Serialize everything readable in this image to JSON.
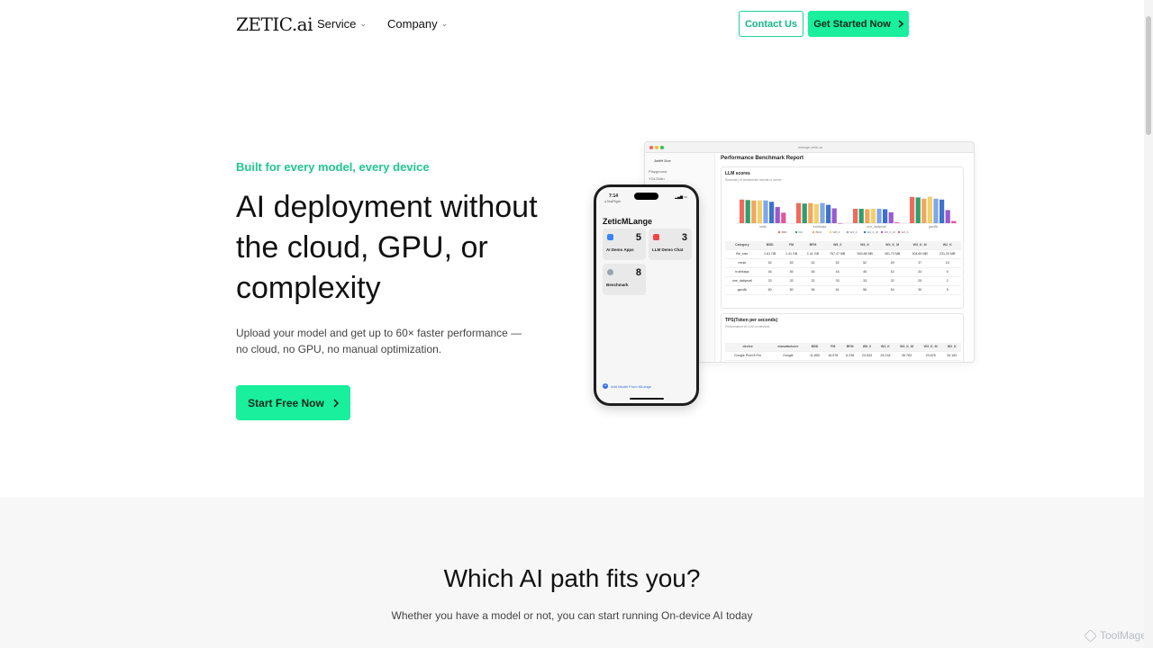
{
  "header": {
    "logo": "ZETIC.ai",
    "nav": [
      {
        "label": "Service"
      },
      {
        "label": "Company"
      }
    ],
    "contact_label": "Contact Us",
    "get_started_label": "Get Started Now"
  },
  "hero": {
    "eyebrow": "Built for every model, every device",
    "title": "AI deployment without the cloud, GPU, or complexity",
    "subtitle": "Upload your model and get up to 60× faster performance — no cloud, no GPU, no manual optimization.",
    "cta_label": "Start Free Now"
  },
  "browser_mock": {
    "url": "mlange.zetic.ai",
    "sidebar_user": "JaHH Doe",
    "sidebar_items": [
      "Playground",
      "YOLOv8n"
    ],
    "report_title": "Performance Benchmark Report",
    "llm_card_title": "LLM scores",
    "llm_card_subtitle": "Summary of benchmark results in server",
    "chart_groups": [
      "mmlu",
      "truthfulqa",
      "one_dailymail",
      "gsm8k"
    ],
    "chart_legend": [
      "BBD",
      "FM",
      "BFM",
      "W8_0",
      "W4_K",
      "W4_K_M",
      "W3_K_M",
      "W2_K"
    ],
    "score_table": {
      "headers": [
        "Category",
        "BBD",
        "FM",
        "BFM",
        "W8_0",
        "W4_K",
        "W4_K_M",
        "W3_K_M",
        "W2_K"
      ],
      "rows": [
        [
          "file_size",
          "2.81 GB",
          "1.41 GB",
          "1.41 GB",
          "767.47 MB",
          "593.88 MB",
          "451.73 MB",
          "304.60 MB",
          "231.20 MB"
        ],
        [
          "mmlu",
          "54",
          "53",
          "52",
          "52",
          "52",
          "49",
          "37",
          "24"
        ],
        [
          "truthfulqa",
          "46",
          "45",
          "46",
          "44",
          "46",
          "42",
          "34",
          "0"
        ],
        [
          "one_dailymail",
          "33",
          "33",
          "32",
          "33",
          "33",
          "32",
          "25",
          "2"
        ],
        [
          "gsm8k",
          "60",
          "59",
          "56",
          "61",
          "56",
          "54",
          "30",
          "5"
        ]
      ]
    },
    "tps_card_title": "TPS(Token per seconds)",
    "tps_card_subtitle": "Performance of LLM on devices",
    "tps_table": {
      "headers": [
        "device",
        "manufacturer",
        "BBD",
        "FM",
        "BFM",
        "W8_0",
        "W4_K",
        "W4_K_M",
        "W3_K_M",
        "W2_K"
      ],
      "rows": [
        [
          "Google Pixel 8 Pro",
          "Google",
          "11.850",
          "16.578",
          "6.238",
          "23.543",
          "25.218",
          "36.783",
          "29.878",
          "34.162"
        ]
      ]
    }
  },
  "phone_mock": {
    "time": "7:14",
    "back": "◂ TestFlight",
    "app_title": "ZeticMLange",
    "tiles": [
      {
        "count": "5",
        "label": "AI Demo Apps",
        "color": "#3b82f6"
      },
      {
        "count": "3",
        "label": "LLM Demo Chat",
        "color": "#ef4444"
      },
      {
        "count": "8",
        "label": "Benchmark",
        "color": "#9ca3af"
      }
    ],
    "add_label": "Add Model From MLange"
  },
  "section2": {
    "title": "Which AI path fits you?",
    "subtitle": "Whether you have a model or not, you can start running On-device AI today"
  },
  "watermark": "ToolMage",
  "colors": {
    "accent": "#19ef9d",
    "accent_text": "#21c78f",
    "bar_palette": [
      "#ef6a5a",
      "#2f9e6e",
      "#f2a65a",
      "#f2d16b",
      "#7fa6e8",
      "#3c72c9",
      "#9b59d0",
      "#e2579a"
    ]
  }
}
